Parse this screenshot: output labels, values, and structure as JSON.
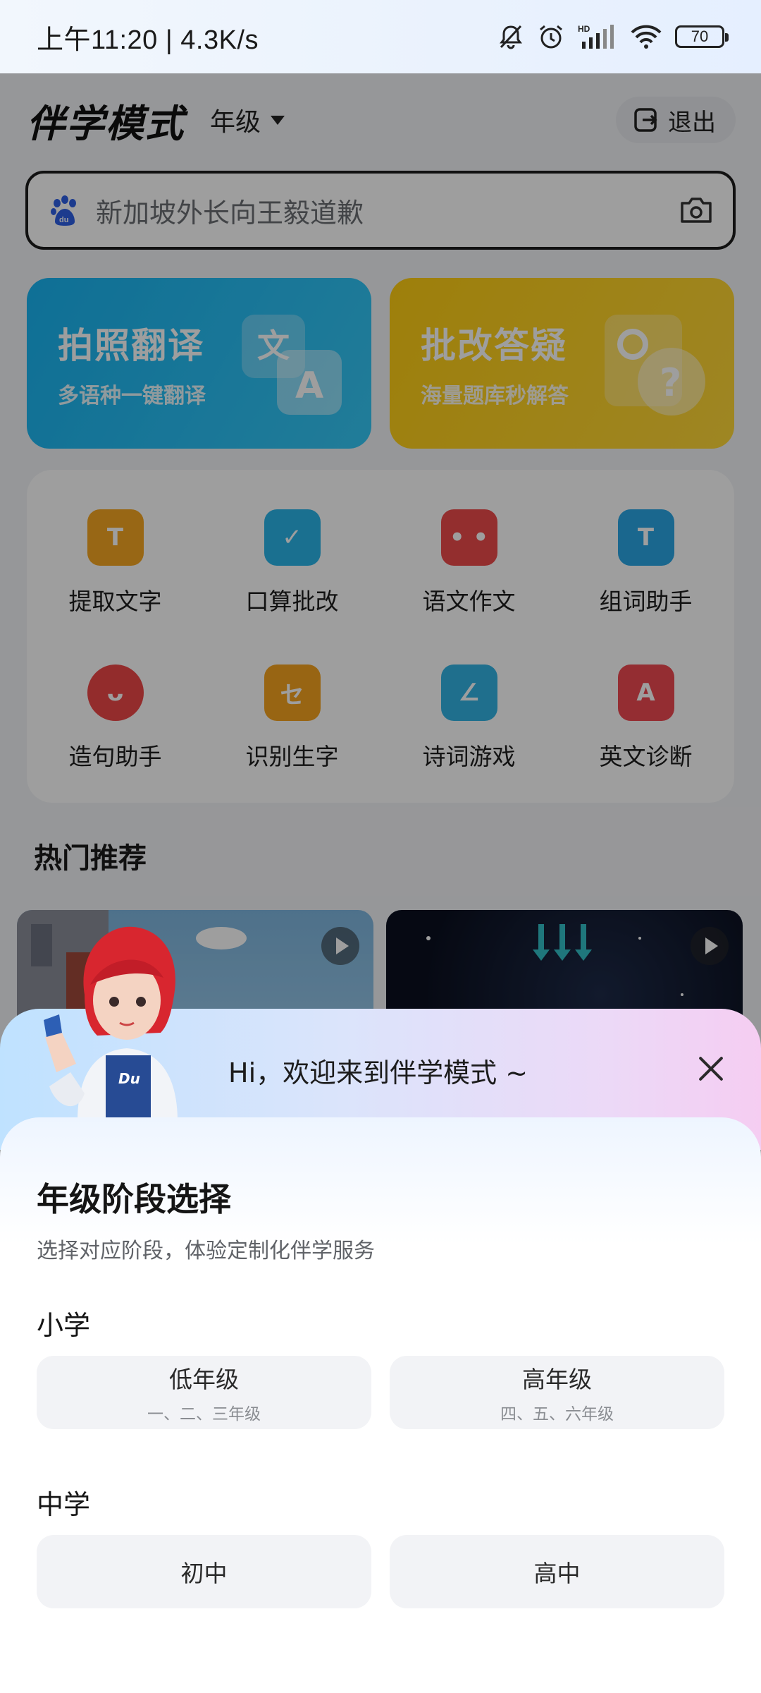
{
  "status_bar": {
    "time": "上午11:20 | 4.3K/s",
    "battery": "70",
    "icons": [
      "mute-icon",
      "alarm-icon",
      "hd-signal-icon",
      "wifi-icon",
      "battery-icon"
    ]
  },
  "header": {
    "title": "伴学模式",
    "grade_label": "年级",
    "exit_label": "退出"
  },
  "search": {
    "placeholder": "新加坡外长向王毅道歉"
  },
  "cards": [
    {
      "title": "拍照翻译",
      "subtitle": "多语种一键翻译",
      "color": "#1ab6f3"
    },
    {
      "title": "批改答疑",
      "subtitle": "海量题库秒解答",
      "color": "#ffcf15"
    }
  ],
  "tools": [
    {
      "label": "提取文字",
      "glyph": "T",
      "color": "#f5a623"
    },
    {
      "label": "口算批改",
      "glyph": "✓",
      "color": "#2bb5e8"
    },
    {
      "label": "语文作文",
      "glyph": "• •",
      "color": "#ee4b4b"
    },
    {
      "label": "组词助手",
      "glyph": "T",
      "color": "#2aa7e6"
    },
    {
      "label": "造句助手",
      "glyph": "ᴗ",
      "color": "#ee4747"
    },
    {
      "label": "识别生字",
      "glyph": "セ",
      "color": "#f5a41f"
    },
    {
      "label": "诗词游戏",
      "glyph": "∠",
      "color": "#33b4e4"
    },
    {
      "label": "英文诊断",
      "glyph": "A",
      "color": "#ef4a52"
    }
  ],
  "section": {
    "hot_title": "热门推荐"
  },
  "sheet": {
    "greeting": "Hi，欢迎来到伴学模式 ~",
    "title": "年级阶段选择",
    "subtitle": "选择对应阶段，体验定制化伴学服务",
    "primary": {
      "label": "小学",
      "options": [
        {
          "main": "低年级",
          "sub": "一、二、三年级"
        },
        {
          "main": "高年级",
          "sub": "四、五、六年级"
        }
      ]
    },
    "middle": {
      "label": "中学",
      "options": [
        {
          "main": "初中"
        },
        {
          "main": "高中"
        }
      ]
    }
  }
}
